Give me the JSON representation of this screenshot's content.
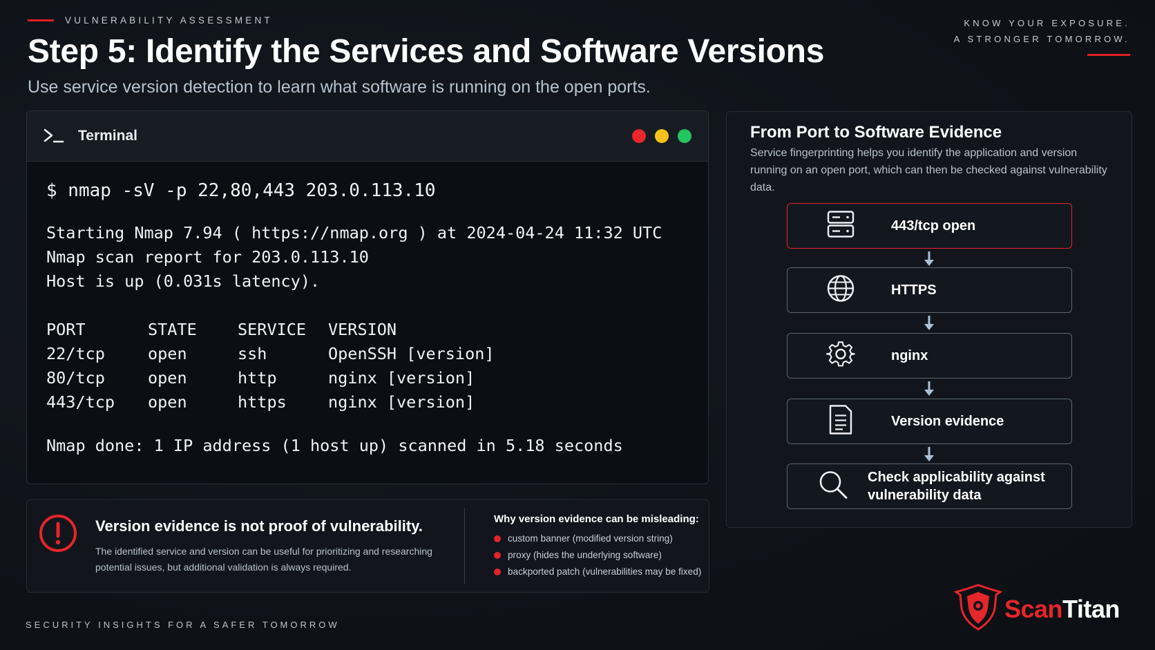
{
  "header": {
    "eyebrow": "VULNERABILITY ASSESSMENT",
    "title": "Step 5: Identify the Services and Software Versions",
    "subtitle": "Use service version detection to learn what software is running on the open ports.",
    "tagline_1": "KNOW YOUR EXPOSURE.",
    "tagline_2": "A STRONGER TOMORROW."
  },
  "terminal": {
    "title": "Terminal",
    "command": "$ nmap -sV -p 22,80,443  203.0.113.10",
    "output": [
      "Starting Nmap 7.94 ( https://nmap.org ) at 2024-04-24 11:32 UTC",
      "Nmap scan report for 203.0.113.10",
      "Host is up (0.031s latency)."
    ],
    "table_headers": [
      "PORT",
      "STATE",
      "SERVICE",
      "VERSION"
    ],
    "rows": [
      [
        "22/tcp",
        "open",
        "ssh",
        "OpenSSH [version]"
      ],
      [
        "80/tcp",
        "open",
        "http",
        "nginx [version]"
      ],
      [
        "443/tcp",
        "open",
        "https",
        "nginx [version]"
      ]
    ],
    "done": "Nmap done: 1 IP address (1 host up) scanned in 5.18 seconds",
    "dot_colors": [
      "#e8262b",
      "#f4c21a",
      "#22c55e"
    ]
  },
  "warning": {
    "title": "Version evidence is not proof of vulnerability.",
    "text": "The identified service and version can be useful for prioritizing and researching potential issues, but additional validation is always required.",
    "why_title": "Why version evidence can be misleading:",
    "reasons": [
      "custom banner (modified version string)",
      "proxy (hides the underlying software)",
      "backported patch (vulnerabilities may be fixed)"
    ]
  },
  "flow": {
    "title": "From Port to Software Evidence",
    "text": "Service fingerprinting helps you identify the application and version running on an open port, which can then be checked against vulnerability data.",
    "steps": [
      {
        "label": "443/tcp open",
        "icon": "server-icon"
      },
      {
        "label": "HTTPS",
        "icon": "globe-icon"
      },
      {
        "label": "nginx",
        "icon": "gear-icon"
      },
      {
        "label": "Version evidence",
        "icon": "document-icon"
      },
      {
        "label": "Check applicability against vulnerability data",
        "icon": "search-icon"
      }
    ]
  },
  "footer": {
    "text": "SECURITY INSIGHTS FOR A SAFER TOMORROW",
    "brand_a": "Scan",
    "brand_b": "Titan"
  },
  "colors": {
    "accent": "#e5262b",
    "background": "#0f1318"
  }
}
